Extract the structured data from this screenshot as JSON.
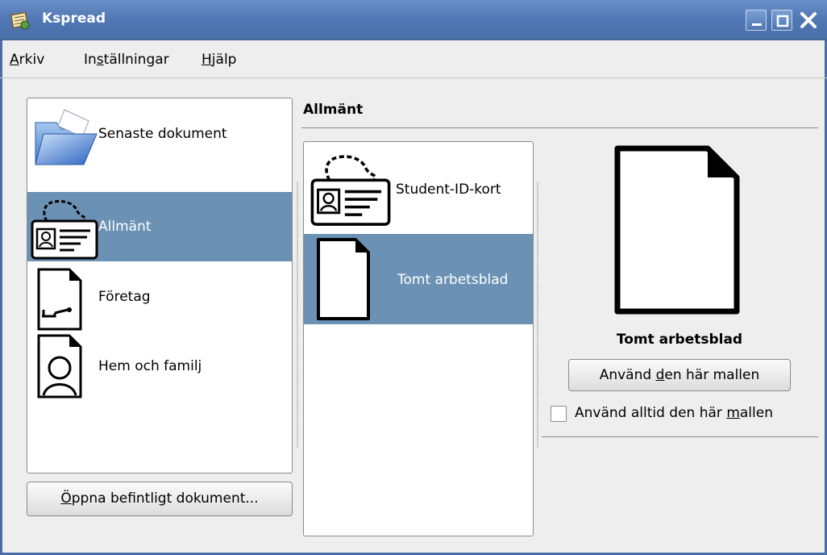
{
  "window": {
    "title": "Kspread",
    "icons": {
      "app": "kspread-app-icon",
      "minimize": "minimize-icon",
      "maximize": "maximize-icon",
      "close": "close-icon"
    }
  },
  "menubar": {
    "items": [
      {
        "pre": "",
        "accel": "A",
        "post": "rkiv"
      },
      {
        "pre": "In",
        "accel": "s",
        "post": "tällningar"
      },
      {
        "pre": "",
        "accel": "H",
        "post": "jälp"
      }
    ]
  },
  "categories": [
    {
      "label": "Senaste dokument",
      "icon": "open-folder-icon",
      "selected": false
    },
    {
      "label": "Allmänt",
      "icon": "id-card-icon",
      "selected": true
    },
    {
      "label": "Företag",
      "icon": "business-document-icon",
      "selected": false
    },
    {
      "label": "Hem och familj",
      "icon": "family-document-icon",
      "selected": false
    }
  ],
  "open_existing": {
    "pre": "",
    "accel": "Ö",
    "post": "ppna befintligt dokument..."
  },
  "section": {
    "title": "Allmänt"
  },
  "templates": [
    {
      "label": "Student-ID-kort",
      "icon": "id-card-icon",
      "selected": false
    },
    {
      "label": "Tomt arbetsblad",
      "icon": "blank-sheet-icon",
      "selected": true
    }
  ],
  "preview": {
    "name": "Tomt arbetsblad",
    "icon": "blank-sheet-large-icon",
    "use_button": {
      "pre": "Använd ",
      "accel": "d",
      "post": "en här mallen"
    },
    "always_use": {
      "pre": "Använd alltid den här ",
      "accel": "m",
      "post": "allen",
      "checked": false
    }
  },
  "colors": {
    "selection": "#6b91b4",
    "titlebar": "#5077b4"
  }
}
